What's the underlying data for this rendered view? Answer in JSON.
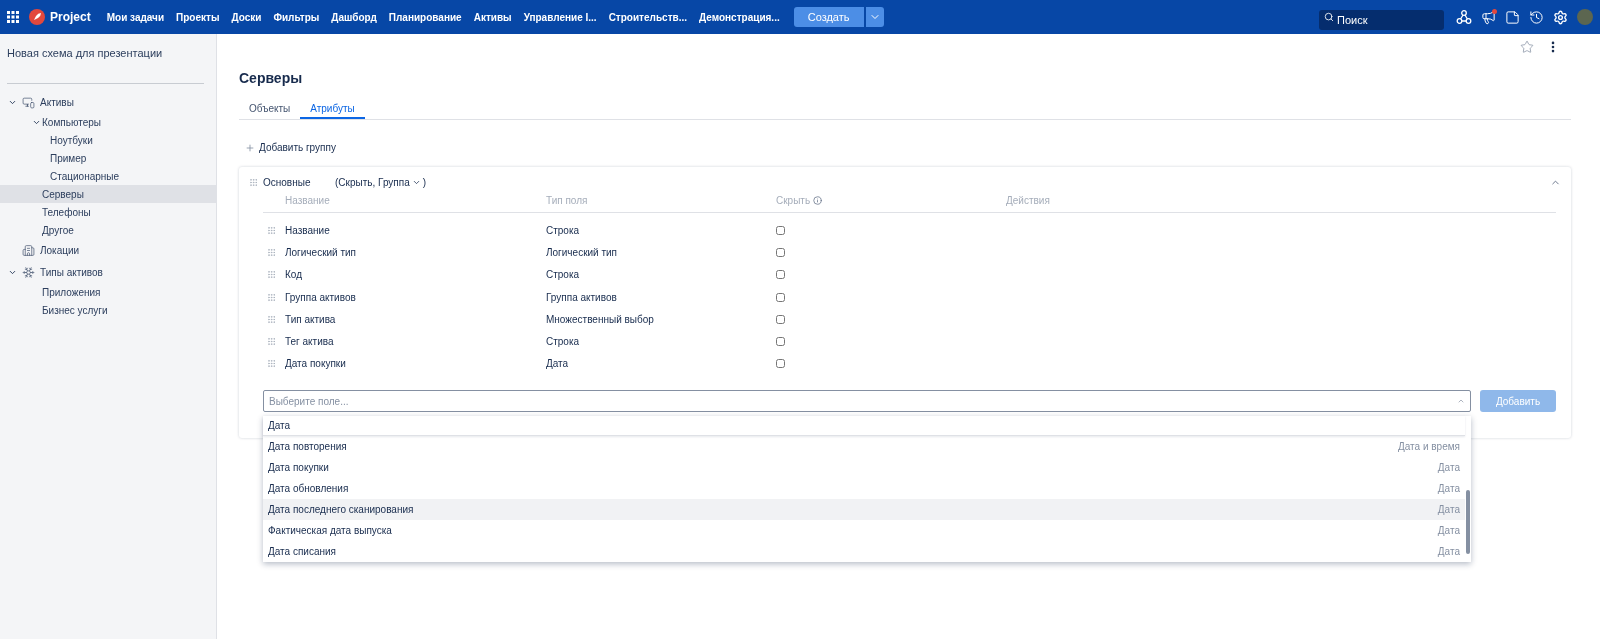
{
  "topbar": {
    "logo": "Project",
    "nav": [
      "Мои задачи",
      "Проекты",
      "Доски",
      "Фильтры",
      "Дашборд",
      "Планирование",
      "Активы",
      "Управление I...",
      "Строительств...",
      "Демонстрация..."
    ],
    "create_button": "Создать",
    "search": {
      "placeholder": "Поиск"
    }
  },
  "sidebar": {
    "title": "Новая схема для презентации",
    "tree": [
      {
        "label": "Активы",
        "selected": false,
        "expanded": true,
        "children": [
          {
            "label": "Компьютеры",
            "selected": false,
            "expanded": true,
            "children": [
              {
                "label": "Ноутбуки",
                "selected": false
              },
              {
                "label": "Пример",
                "selected": false
              },
              {
                "label": "Стационарные",
                "selected": false
              }
            ]
          },
          {
            "label": "Серверы",
            "selected": true
          },
          {
            "label": "Телефоны",
            "selected": false
          },
          {
            "label": "Другое",
            "selected": false
          }
        ]
      },
      {
        "label": "Локации",
        "selected": false
      },
      {
        "label": "Типы активов",
        "selected": false,
        "expanded": true,
        "children": [
          {
            "label": "Приложения",
            "selected": false
          },
          {
            "label": "Бизнес услуги",
            "selected": false
          }
        ]
      }
    ]
  },
  "page": {
    "title": "Серверы",
    "tabs": [
      {
        "label": "Объекты",
        "selected": false
      },
      {
        "label": "Атрибуты",
        "selected": true
      }
    ],
    "add_group": "Добавить группу",
    "group": {
      "name": "Основные",
      "options": "(Скрыть, Группа",
      "options_end": ")",
      "expanded": true,
      "columns": [
        "Название",
        "Тип поля",
        "Скрыть",
        "Действия"
      ],
      "rows": [
        {
          "name": "Название",
          "type": "Строка",
          "hidden": false
        },
        {
          "name": "Логический тип",
          "type": "Логический тип",
          "hidden": false
        },
        {
          "name": "Код",
          "type": "Строка",
          "hidden": false
        },
        {
          "name": "Группа активов",
          "type": "Группа активов",
          "hidden": false
        },
        {
          "name": "Тип актива",
          "type": "Множественный выбор",
          "hidden": false
        },
        {
          "name": "Тег актива",
          "type": "Строка",
          "hidden": false
        },
        {
          "name": "Дата покупки",
          "type": "Дата",
          "hidden": false
        }
      ]
    },
    "field_select": {
      "placeholder": "Выберите поле...",
      "open": true
    },
    "add_button": {
      "label": "Добавить",
      "disabled": true
    },
    "dropdown": {
      "group_label": "Дата",
      "options": [
        {
          "label": "Дата повторения",
          "type": "Дата и время",
          "selected": false
        },
        {
          "label": "Дата покупки",
          "type": "Дата",
          "selected": false
        },
        {
          "label": "Дата обновления",
          "type": "Дата",
          "selected": false
        },
        {
          "label": "Дата последнего сканирования",
          "type": "Дата",
          "selected": true
        },
        {
          "label": "Фактическая дата выпуска",
          "type": "Дата",
          "selected": false
        },
        {
          "label": "Дата списания",
          "type": "Дата",
          "selected": false
        }
      ]
    }
  }
}
